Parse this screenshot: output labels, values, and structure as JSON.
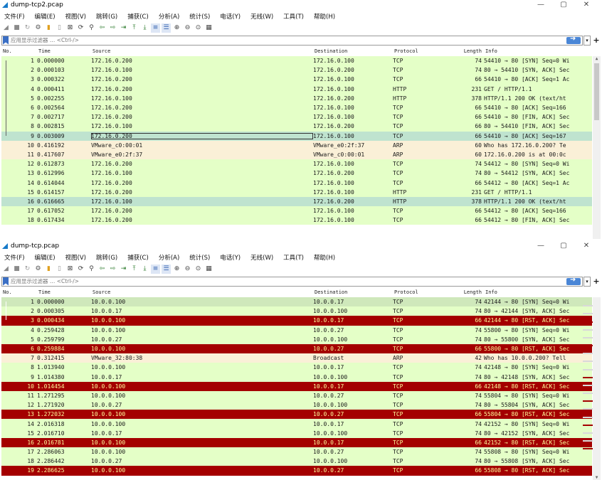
{
  "colors": {
    "tcp_green": "#e4ffc7",
    "http_green": "#e4ffc7",
    "arp_tan": "#faf0d7",
    "selected": "#bfe3cf",
    "rst_red": "#a40000",
    "rst_text": "#fffc9c",
    "header_gray": "#ffffff"
  },
  "menu": [
    "文件(F)",
    "编辑(E)",
    "视图(V)",
    "跳转(G)",
    "捕获(C)",
    "分析(A)",
    "统计(S)",
    "电话(Y)",
    "无线(W)",
    "工具(T)",
    "帮助(H)"
  ],
  "toolbar_icons": [
    "shark-fin-start-icon",
    "stop-square-icon",
    "restart-icon",
    "options-gear-icon",
    "open-folder-icon",
    "save-file-icon",
    "close-file-icon",
    "reload-icon",
    "find-icon",
    "back-arrow-icon",
    "forward-arrow-icon",
    "goto-packet-icon",
    "first-packet-icon",
    "last-packet-icon",
    "autoscroll-icon",
    "colorize-icon",
    "zoom-in-icon",
    "zoom-out-icon",
    "zoom-reset-icon",
    "resize-columns-icon"
  ],
  "filter": {
    "placeholder": "应用显示过滤器 … <Ctrl-/>"
  },
  "columns": [
    "No.",
    "Time",
    "Source",
    "Destination",
    "Protocol",
    "Length",
    "Info"
  ],
  "window_controls": {
    "minimize": "—",
    "maximize": "▢",
    "close": "✕"
  },
  "windows": [
    {
      "title": "dump-tcp2.pcap",
      "rows": [
        {
          "no": "1",
          "time": "0.000000",
          "src": "172.16.0.200",
          "dst": "172.16.0.100",
          "proto": "TCP",
          "len": "74",
          "info": "54410 → 80 [SYN] Seq=0 Wi",
          "kind": "tcp"
        },
        {
          "no": "2",
          "time": "0.000103",
          "src": "172.16.0.100",
          "dst": "172.16.0.200",
          "proto": "TCP",
          "len": "74",
          "info": "80 → 54410 [SYN, ACK] Sec",
          "kind": "tcp"
        },
        {
          "no": "3",
          "time": "0.000322",
          "src": "172.16.0.200",
          "dst": "172.16.0.100",
          "proto": "TCP",
          "len": "66",
          "info": "54410 → 80 [ACK] Seq=1 Ac",
          "kind": "tcp"
        },
        {
          "no": "4",
          "time": "0.000411",
          "src": "172.16.0.200",
          "dst": "172.16.0.100",
          "proto": "HTTP",
          "len": "231",
          "info": "GET / HTTP/1.1",
          "kind": "http"
        },
        {
          "no": "5",
          "time": "0.002255",
          "src": "172.16.0.100",
          "dst": "172.16.0.200",
          "proto": "HTTP",
          "len": "378",
          "info": "HTTP/1.1 200 OK  (text/ht",
          "kind": "http"
        },
        {
          "no": "6",
          "time": "0.002564",
          "src": "172.16.0.200",
          "dst": "172.16.0.100",
          "proto": "TCP",
          "len": "66",
          "info": "54410 → 80 [ACK] Seq=166",
          "kind": "tcp"
        },
        {
          "no": "7",
          "time": "0.002717",
          "src": "172.16.0.200",
          "dst": "172.16.0.100",
          "proto": "TCP",
          "len": "66",
          "info": "54410 → 80 [FIN, ACK] Sec",
          "kind": "tcp"
        },
        {
          "no": "8",
          "time": "0.002815",
          "src": "172.16.0.100",
          "dst": "172.16.0.200",
          "proto": "TCP",
          "len": "66",
          "info": "80 → 54410 [FIN, ACK] Sec",
          "kind": "tcp"
        },
        {
          "no": "9",
          "time": "0.003009",
          "src": "172.16.0.200",
          "dst": "172.16.0.100",
          "proto": "TCP",
          "len": "66",
          "info": "54410 → 80 [ACK] Seq=167",
          "kind": "selected"
        },
        {
          "no": "10",
          "time": "0.416192",
          "src": "VMware_c0:00:01",
          "dst": "VMware_e0:2f:37",
          "proto": "ARP",
          "len": "60",
          "info": "Who has 172.16.0.200? Te",
          "kind": "arp"
        },
        {
          "no": "11",
          "time": "0.417607",
          "src": "VMware_e0:2f:37",
          "dst": "VMware_c0:00:01",
          "proto": "ARP",
          "len": "60",
          "info": "172.16.0.200 is at 00:0c",
          "kind": "arp"
        },
        {
          "no": "12",
          "time": "0.612873",
          "src": "172.16.0.200",
          "dst": "172.16.0.100",
          "proto": "TCP",
          "len": "74",
          "info": "54412 → 80 [SYN] Seq=0 Wi",
          "kind": "tcp"
        },
        {
          "no": "13",
          "time": "0.612996",
          "src": "172.16.0.100",
          "dst": "172.16.0.200",
          "proto": "TCP",
          "len": "74",
          "info": "80 → 54412 [SYN, ACK] Sec",
          "kind": "tcp"
        },
        {
          "no": "14",
          "time": "0.614044",
          "src": "172.16.0.200",
          "dst": "172.16.0.100",
          "proto": "TCP",
          "len": "66",
          "info": "54412 → 80 [ACK] Seq=1 Ac",
          "kind": "tcp"
        },
        {
          "no": "15",
          "time": "0.614157",
          "src": "172.16.0.200",
          "dst": "172.16.0.100",
          "proto": "HTTP",
          "len": "231",
          "info": "GET / HTTP/1.1",
          "kind": "http"
        },
        {
          "no": "16",
          "time": "0.616665",
          "src": "172.16.0.100",
          "dst": "172.16.0.200",
          "proto": "HTTP",
          "len": "378",
          "info": "HTTP/1.1 200 OK  (text/ht",
          "kind": "http2"
        },
        {
          "no": "17",
          "time": "0.617052",
          "src": "172.16.0.200",
          "dst": "172.16.0.100",
          "proto": "TCP",
          "len": "66",
          "info": "54412 → 80 [ACK] Seq=166",
          "kind": "tcp"
        },
        {
          "no": "18",
          "time": "0.617434",
          "src": "172.16.0.200",
          "dst": "172.16.0.100",
          "proto": "TCP",
          "len": "66",
          "info": "54412 → 80 [FIN, ACK] Sec",
          "kind": "tcp"
        }
      ]
    },
    {
      "title": "dump-tcp.pcap",
      "rows": [
        {
          "no": "1",
          "time": "0.000000",
          "src": "10.0.0.100",
          "dst": "10.0.0.17",
          "proto": "TCP",
          "len": "74",
          "info": "42144 → 80 [SYN] Seq=0 Wi",
          "kind": "tcpsel"
        },
        {
          "no": "2",
          "time": "0.000305",
          "src": "10.0.0.17",
          "dst": "10.0.0.100",
          "proto": "TCP",
          "len": "74",
          "info": "80 → 42144 [SYN, ACK] Sec",
          "kind": "tcp"
        },
        {
          "no": "3",
          "time": "0.000434",
          "src": "10.0.0.100",
          "dst": "10.0.0.17",
          "proto": "TCP",
          "len": "66",
          "info": "42144 → 80 [RST, ACK] Sec",
          "kind": "rst"
        },
        {
          "no": "4",
          "time": "0.259428",
          "src": "10.0.0.100",
          "dst": "10.0.0.27",
          "proto": "TCP",
          "len": "74",
          "info": "55800 → 80 [SYN] Seq=0 Wi",
          "kind": "tcp"
        },
        {
          "no": "5",
          "time": "0.259799",
          "src": "10.0.0.27",
          "dst": "10.0.0.100",
          "proto": "TCP",
          "len": "74",
          "info": "80 → 55800 [SYN, ACK] Sec",
          "kind": "tcp"
        },
        {
          "no": "6",
          "time": "0.259884",
          "src": "10.0.0.100",
          "dst": "10.0.0.27",
          "proto": "TCP",
          "len": "66",
          "info": "55800 → 80 [RST, ACK] Sec",
          "kind": "rst"
        },
        {
          "no": "7",
          "time": "0.312415",
          "src": "VMware_32:80:38",
          "dst": "Broadcast",
          "proto": "ARP",
          "len": "42",
          "info": "Who has 10.0.0.200? Tell",
          "kind": "arp"
        },
        {
          "no": "8",
          "time": "1.013940",
          "src": "10.0.0.100",
          "dst": "10.0.0.17",
          "proto": "TCP",
          "len": "74",
          "info": "42148 → 80 [SYN] Seq=0 Wi",
          "kind": "tcp"
        },
        {
          "no": "9",
          "time": "1.014380",
          "src": "10.0.0.17",
          "dst": "10.0.0.100",
          "proto": "TCP",
          "len": "74",
          "info": "80 → 42148 [SYN, ACK] Sec",
          "kind": "tcp"
        },
        {
          "no": "10",
          "time": "1.014454",
          "src": "10.0.0.100",
          "dst": "10.0.0.17",
          "proto": "TCP",
          "len": "66",
          "info": "42148 → 80 [RST, ACK] Sec",
          "kind": "rst"
        },
        {
          "no": "11",
          "time": "1.271295",
          "src": "10.0.0.100",
          "dst": "10.0.0.27",
          "proto": "TCP",
          "len": "74",
          "info": "55804 → 80 [SYN] Seq=0 Wi",
          "kind": "tcp"
        },
        {
          "no": "12",
          "time": "1.271920",
          "src": "10.0.0.27",
          "dst": "10.0.0.100",
          "proto": "TCP",
          "len": "74",
          "info": "80 → 55804 [SYN, ACK] Sec",
          "kind": "tcp"
        },
        {
          "no": "13",
          "time": "1.272032",
          "src": "10.0.0.100",
          "dst": "10.0.0.27",
          "proto": "TCP",
          "len": "66",
          "info": "55804 → 80 [RST, ACK] Sec",
          "kind": "rst"
        },
        {
          "no": "14",
          "time": "2.016318",
          "src": "10.0.0.100",
          "dst": "10.0.0.17",
          "proto": "TCP",
          "len": "74",
          "info": "42152 → 80 [SYN] Seq=0 Wi",
          "kind": "tcp"
        },
        {
          "no": "15",
          "time": "2.016710",
          "src": "10.0.0.17",
          "dst": "10.0.0.100",
          "proto": "TCP",
          "len": "74",
          "info": "80 → 42152 [SYN, ACK] Sec",
          "kind": "tcp"
        },
        {
          "no": "16",
          "time": "2.016781",
          "src": "10.0.0.100",
          "dst": "10.0.0.17",
          "proto": "TCP",
          "len": "66",
          "info": "42152 → 80 [RST, ACK] Sec",
          "kind": "rst"
        },
        {
          "no": "17",
          "time": "2.286063",
          "src": "10.0.0.100",
          "dst": "10.0.0.27",
          "proto": "TCP",
          "len": "74",
          "info": "55808 → 80 [SYN] Seq=0 Wi",
          "kind": "tcp"
        },
        {
          "no": "18",
          "time": "2.286442",
          "src": "10.0.0.27",
          "dst": "10.0.0.100",
          "proto": "TCP",
          "len": "74",
          "info": "80 → 55808 [SYN, ACK] Sec",
          "kind": "tcp"
        },
        {
          "no": "19",
          "time": "2.286625",
          "src": "10.0.0.100",
          "dst": "10.0.0.27",
          "proto": "TCP",
          "len": "66",
          "info": "55808 → 80 [RST, ACK] Sec",
          "kind": "rst"
        }
      ]
    }
  ]
}
